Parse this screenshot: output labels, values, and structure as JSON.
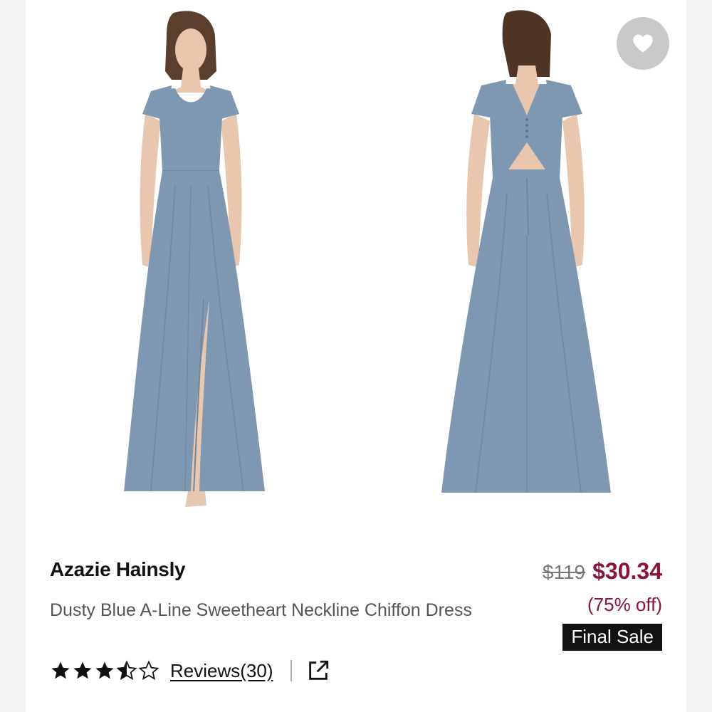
{
  "product": {
    "brand": "Azazie Hainsly",
    "name": "Dusty Blue A-Line Sweetheart Neckline Chiffon Dress",
    "original_price": "$119",
    "sale_price": "$30.34",
    "discount": "(75% off)",
    "badge": "Final Sale",
    "rating": 3.5,
    "rating_max": 5,
    "reviews_label": "Reviews(30)"
  },
  "images": [
    {
      "alt": "front view",
      "icon": "dress-front-photo"
    },
    {
      "alt": "back view",
      "icon": "dress-back-photo"
    }
  ],
  "icons": {
    "favorite": "heart-icon",
    "share": "external-link-icon",
    "star": "star-icon"
  },
  "colors": {
    "dress": "#7f98b2",
    "sale_price": "#8a1538",
    "badge_bg": "#111111",
    "fav_button": "#c9c9c9"
  }
}
